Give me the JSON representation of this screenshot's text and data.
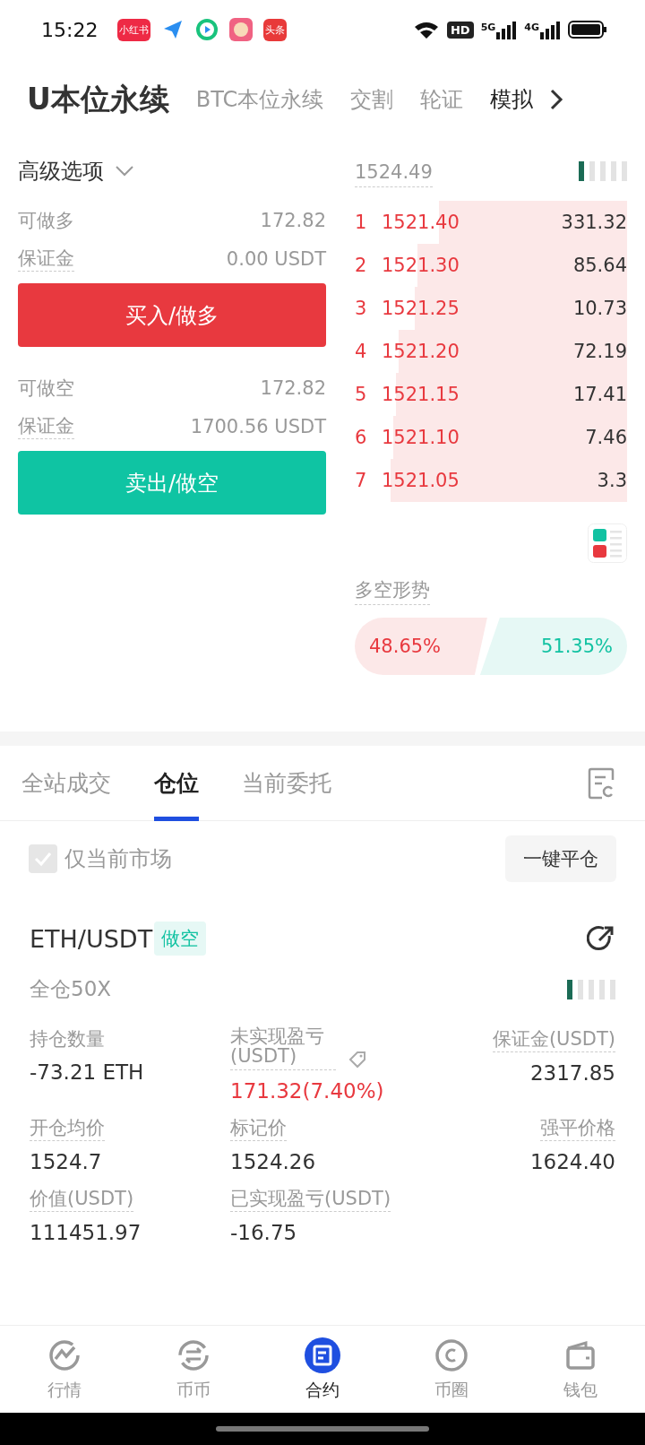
{
  "status_bar": {
    "time": "15:22",
    "network_labels": [
      "HD",
      "5G",
      "4G"
    ],
    "app_icons": [
      {
        "kind": "text",
        "label": "小红书",
        "color": "#ee2a45"
      },
      {
        "kind": "plane",
        "color": "#2a8ef0"
      },
      {
        "kind": "play",
        "color": "#19c37d"
      },
      {
        "kind": "avatar",
        "color": "#f06282"
      },
      {
        "kind": "text",
        "label": "头条",
        "color": "#e83a3a"
      }
    ]
  },
  "header": {
    "tabs": [
      {
        "label": "U本位永续",
        "selected": true,
        "emphasized": false
      },
      {
        "label": "BTC本位永续",
        "selected": false,
        "emphasized": false
      },
      {
        "label": "交割",
        "selected": false,
        "emphasized": false
      },
      {
        "label": "轮证",
        "selected": false,
        "emphasized": false
      },
      {
        "label": "模拟",
        "selected": false,
        "emphasized": true
      }
    ]
  },
  "order_form": {
    "options_label": "高级选项",
    "long": {
      "available_label": "可做多",
      "available": "172.82",
      "margin_label": "保证金",
      "margin": "0.00 USDT",
      "button": "买入/做多"
    },
    "short": {
      "available_label": "可做空",
      "available": "172.82",
      "margin_label": "保证金",
      "margin": "1700.56 USDT",
      "button": "卖出/做空"
    }
  },
  "order_book": {
    "mark_price": "1524.49",
    "asks": [
      {
        "index": "1",
        "price": "1521.40",
        "amount": "331.32"
      },
      {
        "index": "2",
        "price": "1521.30",
        "amount": "85.64"
      },
      {
        "index": "3",
        "price": "1521.25",
        "amount": "10.73"
      },
      {
        "index": "4",
        "price": "1521.20",
        "amount": "72.19"
      },
      {
        "index": "5",
        "price": "1521.15",
        "amount": "17.41"
      },
      {
        "index": "6",
        "price": "1521.10",
        "amount": "7.46"
      },
      {
        "index": "7",
        "price": "1521.05",
        "amount": "3.3"
      }
    ],
    "sentiment": {
      "title": "多空形势",
      "long": "48.65%",
      "short": "51.35%",
      "level": 0.4865
    }
  },
  "tabs": [
    {
      "label": "全站成交",
      "selected": false
    },
    {
      "label": "仓位",
      "selected": true
    },
    {
      "label": "当前委托",
      "selected": false
    }
  ],
  "filter": {
    "label": "仅当前市场",
    "checked": true,
    "close_all_button": "一键平仓"
  },
  "position": {
    "symbol": "ETH/USDT",
    "side": "做空",
    "margin_mode": "全仓50X",
    "fields": [
      {
        "label": "持仓数量",
        "value": "-73.21 ETH",
        "dotted": false,
        "color": "#333333"
      },
      {
        "label": "未实现盈亏(USDT)",
        "value": "171.32(7.40%)",
        "dotted": true,
        "color": "#e8393f"
      },
      {
        "label": "保证金(USDT)",
        "value": "2317.85",
        "dotted": true,
        "color": "#333333"
      },
      {
        "label": "开仓均价",
        "value": "1524.7",
        "dotted": true,
        "color": "#333333"
      },
      {
        "label": "标记价",
        "value": "1524.26",
        "dotted": true,
        "color": "#333333"
      },
      {
        "label": "强平价格",
        "value": "1624.40",
        "dotted": true,
        "color": "#333333"
      },
      {
        "label": "价值(USDT)",
        "value": "111451.97",
        "dotted": true,
        "color": "#333333"
      },
      {
        "label": "已实现盈亏(USDT)",
        "value": "-16.75",
        "dotted": true,
        "color": "#333333"
      }
    ]
  },
  "bottom_nav": [
    {
      "label": "行情",
      "kind": "chart",
      "selected": false
    },
    {
      "label": "币币",
      "kind": "swap",
      "selected": false
    },
    {
      "label": "合约",
      "kind": "contract",
      "selected": true
    },
    {
      "label": "币圈",
      "kind": "coin",
      "selected": false
    },
    {
      "label": "钱包",
      "kind": "wallet",
      "selected": false
    }
  ]
}
